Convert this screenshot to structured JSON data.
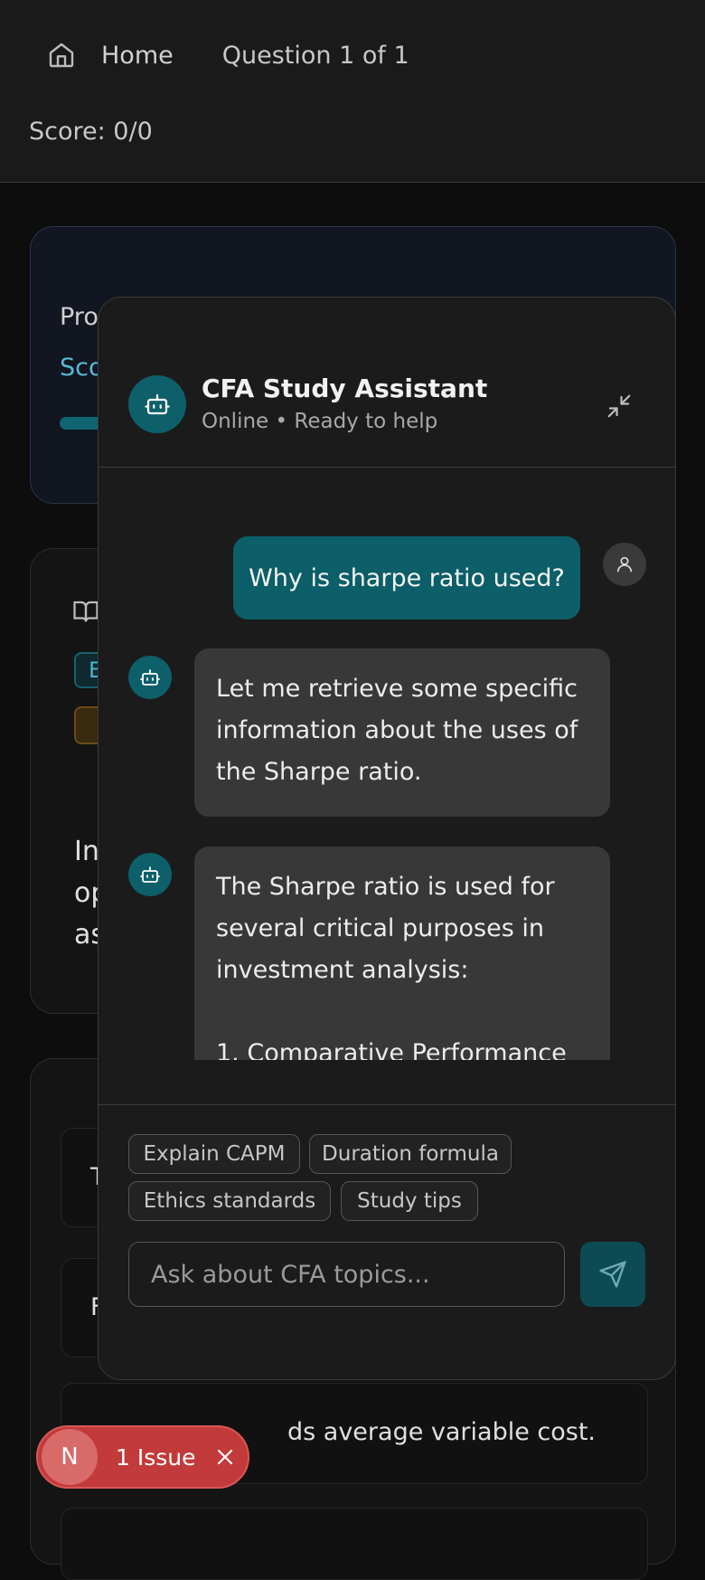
{
  "nav": {
    "home_label": "Home",
    "question_label": "Question 1 of 1",
    "score_label": "Score: 0/0"
  },
  "background": {
    "progress_title_fragment": "Pro",
    "progress_score_fragment": "Sco",
    "tag_blue_fragment": "E",
    "question_text_fragments": [
      "In",
      "op",
      "as"
    ],
    "option_fragments": [
      "T",
      "F"
    ],
    "option_d_visible_text": "ds average variable cost."
  },
  "chat": {
    "title": "CFA Study Assistant",
    "status": "Online • Ready to help",
    "messages": [
      {
        "role": "user",
        "text": "Why is sharpe ratio used?"
      },
      {
        "role": "assistant",
        "lines": [
          "Let me retrieve some specific",
          "information about the uses of",
          "the Sharpe ratio."
        ]
      },
      {
        "role": "assistant",
        "lines": [
          "The Sharpe ratio is used for",
          "several critical purposes in",
          "investment analysis:",
          "",
          "1. Comparative Performance"
        ]
      }
    ],
    "suggestions": [
      "Explain CAPM",
      "Duration formula",
      "Ethics standards",
      "Study tips"
    ],
    "input_placeholder": "Ask about CFA topics..."
  },
  "issue_badge": {
    "avatar_letter": "N",
    "label": "1 Issue"
  },
  "colors": {
    "accent_teal": "#0c5e68",
    "issue_red": "#c23a3a",
    "score_blue": "#5ab8d4"
  }
}
